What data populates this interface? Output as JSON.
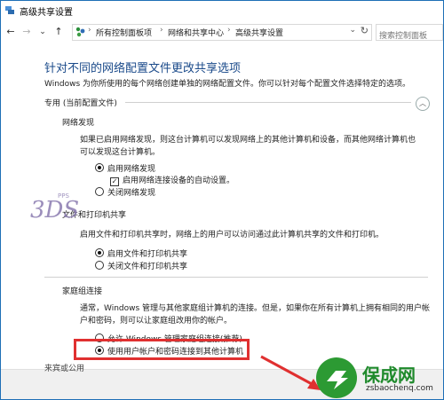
{
  "window": {
    "title": "高级共享设置"
  },
  "nav": {
    "back": "←",
    "forward": "→",
    "recent": "⌄",
    "up": "↑"
  },
  "breadcrumb": [
    "所有控制面板项",
    "网络和共享中心",
    "高级共享设置"
  ],
  "search": {
    "placeholder": "搜索控制面板"
  },
  "page": {
    "heading": "针对不同的网络配置文件更改共享选项",
    "description": "Windows 为你所使用的每个网络创建单独的网络配置文件。你可以针对每个配置文件选择特定的选项。",
    "section_title": "专用 (当前配置文件)",
    "network_discovery": {
      "title": "网络发现",
      "description_line1": "如果已启用网络发现，则这台计算机可以发现网络上的其他计算机和设备，而其他网络计算机也",
      "description_line2": "可以发现这台计算机。",
      "option_on": "启用网络发现",
      "auto_setup": "启用网络连接设备的自动设置。",
      "option_off": "关闭网络发现"
    },
    "file_printer_sharing": {
      "title": "文件和打印机共享",
      "description": "启用文件和打印机共享时，网络上的用户可以访问通过此计算机共享的文件和打印机。",
      "option_on": "启用文件和打印机共享",
      "option_off": "关闭文件和打印机共享"
    },
    "homegroup": {
      "title": "家庭组连接",
      "description_line1": "通常，Windows 管理与其他家庭组计算机的连接。但是，如果你在所有计算机上拥有相同的用户帐",
      "description_line2": "户和密码，则可以让家庭组改用你的帐户。",
      "option_windows": "允许 Windows 管理家庭组连接(推荐)",
      "option_account": "使用用户帐户和密码连接到其他计算机"
    },
    "next_section": "来宾或公用"
  },
  "watermark": {
    "text": "3DS",
    "subtext": "PPS"
  },
  "brand": {
    "name": "保成网",
    "url": "zsbaochenq.com"
  },
  "colors": {
    "accent": "#1a4a8a",
    "highlight": "#e03030",
    "brand": "#2c9a33"
  }
}
